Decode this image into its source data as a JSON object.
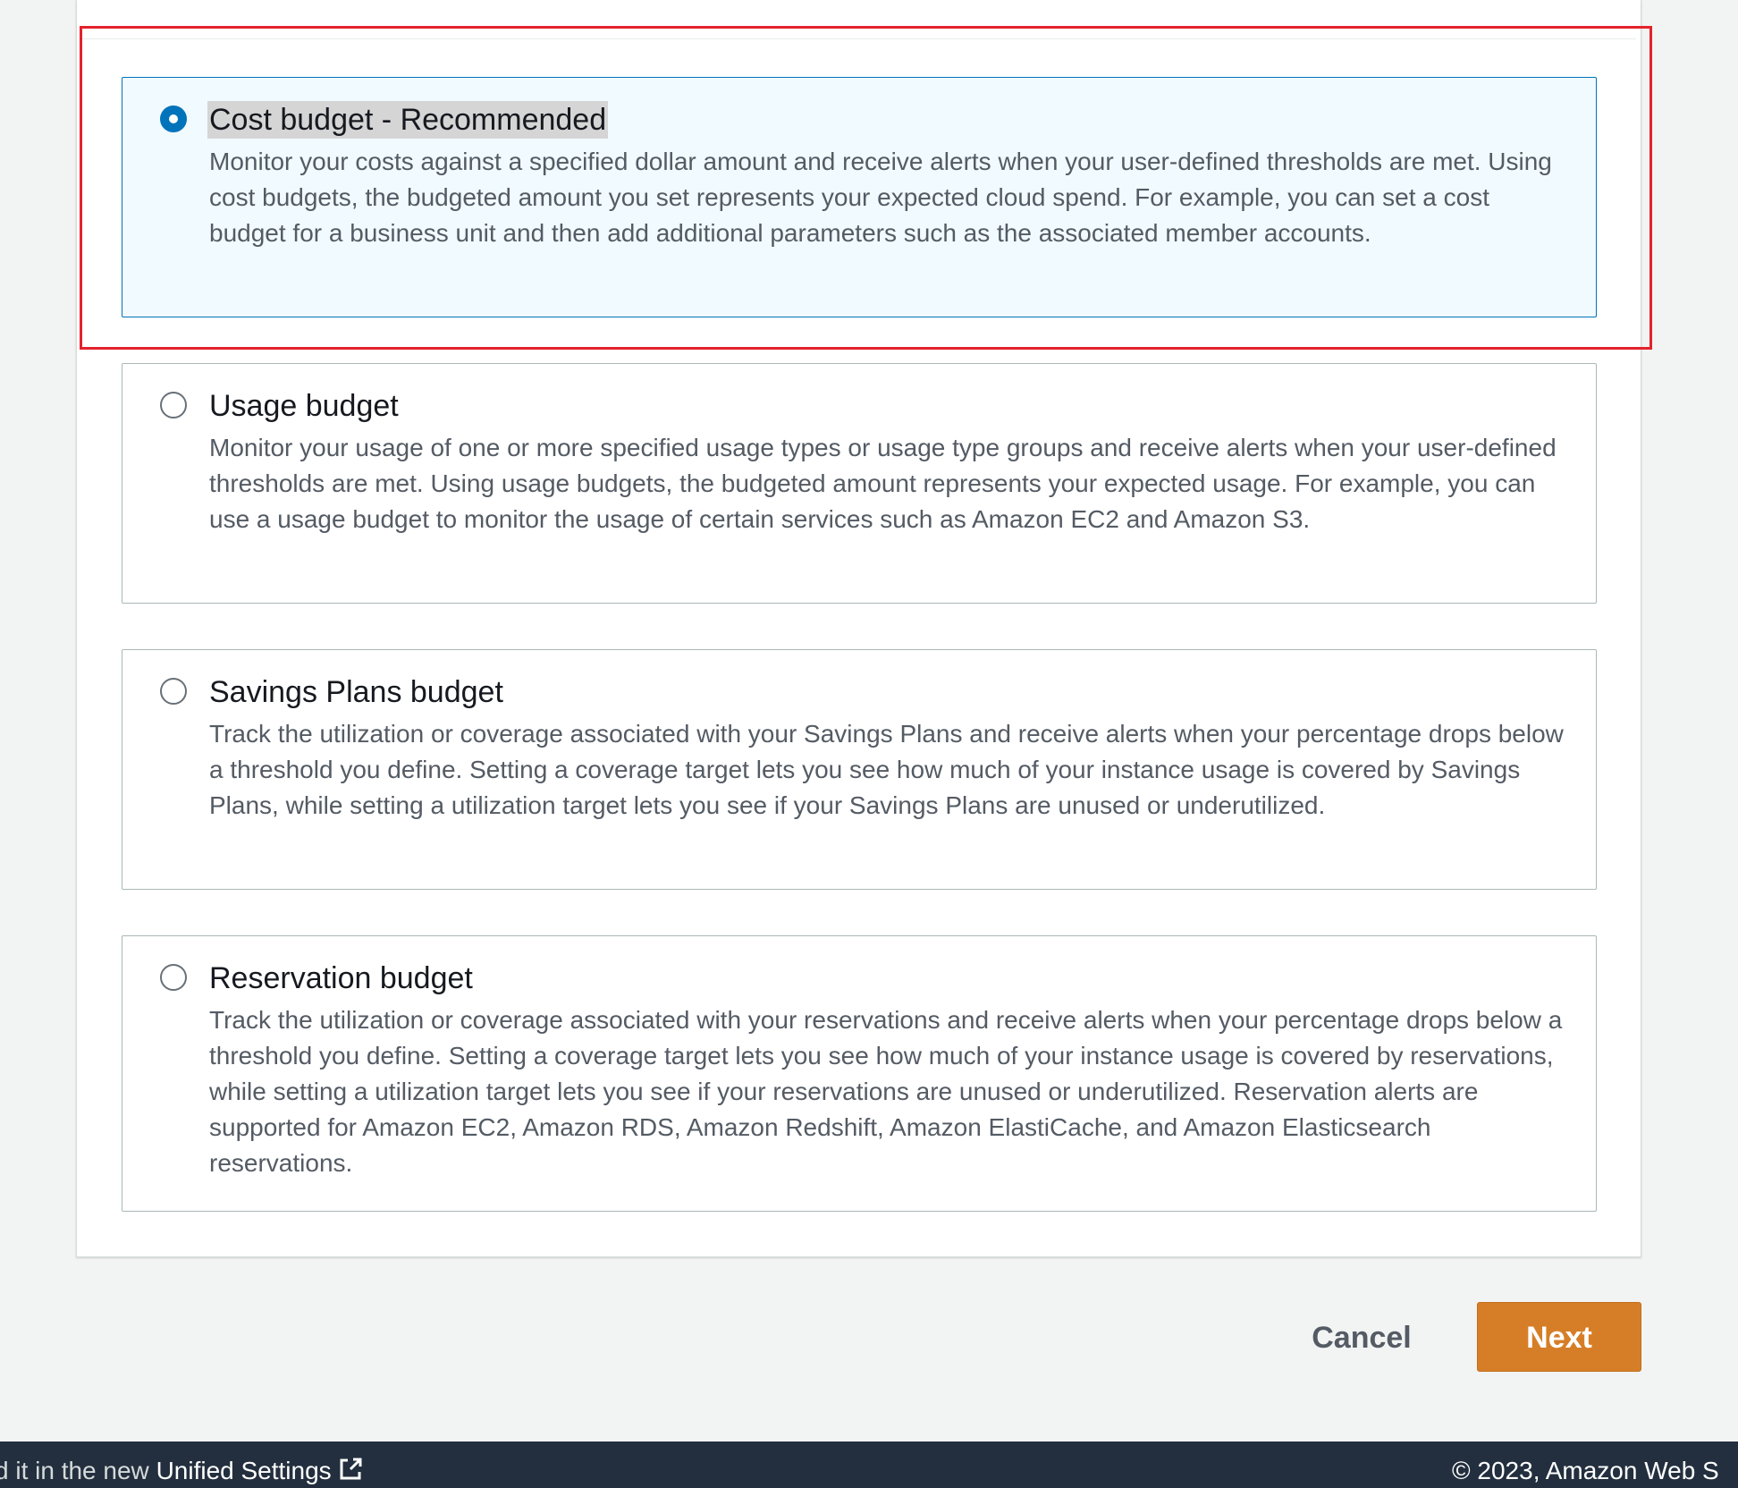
{
  "budget_types": [
    {
      "title": "Cost budget - Recommended",
      "description": "Monitor your costs against a specified dollar amount and receive alerts when your user-defined thresholds are met. Using cost budgets, the budgeted amount you set represents your expected cloud spend. For example, you can set a cost budget for a business unit and then add additional parameters such as the associated member accounts.",
      "selected": true
    },
    {
      "title": "Usage budget",
      "description": "Monitor your usage of one or more specified usage types or usage type groups and receive alerts when your user-defined thresholds are met. Using usage budgets, the budgeted amount represents your expected usage. For example, you can use a usage budget to monitor the usage of certain services such as Amazon EC2 and Amazon S3.",
      "selected": false
    },
    {
      "title": "Savings Plans budget",
      "description": "Track the utilization or coverage associated with your Savings Plans and receive alerts when your percentage drops below a threshold you define. Setting a coverage target lets you see how much of your instance usage is covered by Savings Plans, while setting a utilization target lets you see if your Savings Plans are unused or underutilized.",
      "selected": false
    },
    {
      "title": "Reservation budget",
      "description": "Track the utilization or coverage associated with your reservations and receive alerts when your percentage drops below a threshold you define. Setting a coverage target lets you see how much of your instance usage is covered by reservations, while setting a utilization target lets you see if your reservations are unused or underutilized. Reservation alerts are supported for Amazon EC2, Amazon RDS, Amazon Redshift, Amazon ElastiCache, and Amazon Elasticsearch reservations.",
      "selected": false
    }
  ],
  "actions": {
    "cancel_label": "Cancel",
    "next_label": "Next"
  },
  "footer": {
    "left_text": "d it in the new ",
    "link_text": "Unified Settings",
    "link_icon": "external-link-icon",
    "copyright": "© 2023, Amazon Web S"
  },
  "colors": {
    "accent": "#0073bb",
    "primary_button": "#d67e27",
    "footer_bg": "#232f3e",
    "highlight_box": "#e4222c"
  }
}
